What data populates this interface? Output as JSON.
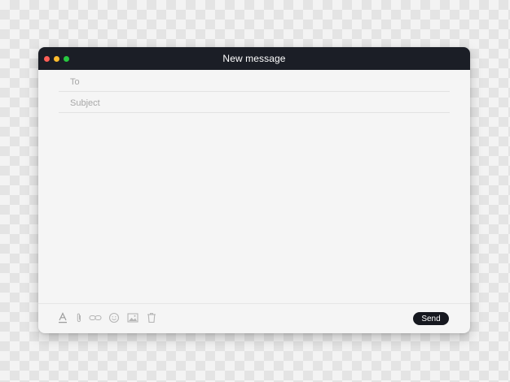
{
  "window": {
    "title": "New message",
    "traffic_lights": {
      "close": "#ff5f57",
      "minimize": "#febc2e",
      "zoom": "#28c840"
    }
  },
  "fields": {
    "to": {
      "placeholder": "To",
      "value": ""
    },
    "subject": {
      "placeholder": "Subject",
      "value": ""
    }
  },
  "body": {
    "value": ""
  },
  "toolbar": {
    "icons": [
      "text-format-icon",
      "attachment-icon",
      "link-icon",
      "emoji-icon",
      "image-icon",
      "trash-icon"
    ],
    "send_label": "Send"
  },
  "colors": {
    "titlebar": "#1b1e26",
    "send_button": "#16181f",
    "icon": "#b5b5b5"
  }
}
